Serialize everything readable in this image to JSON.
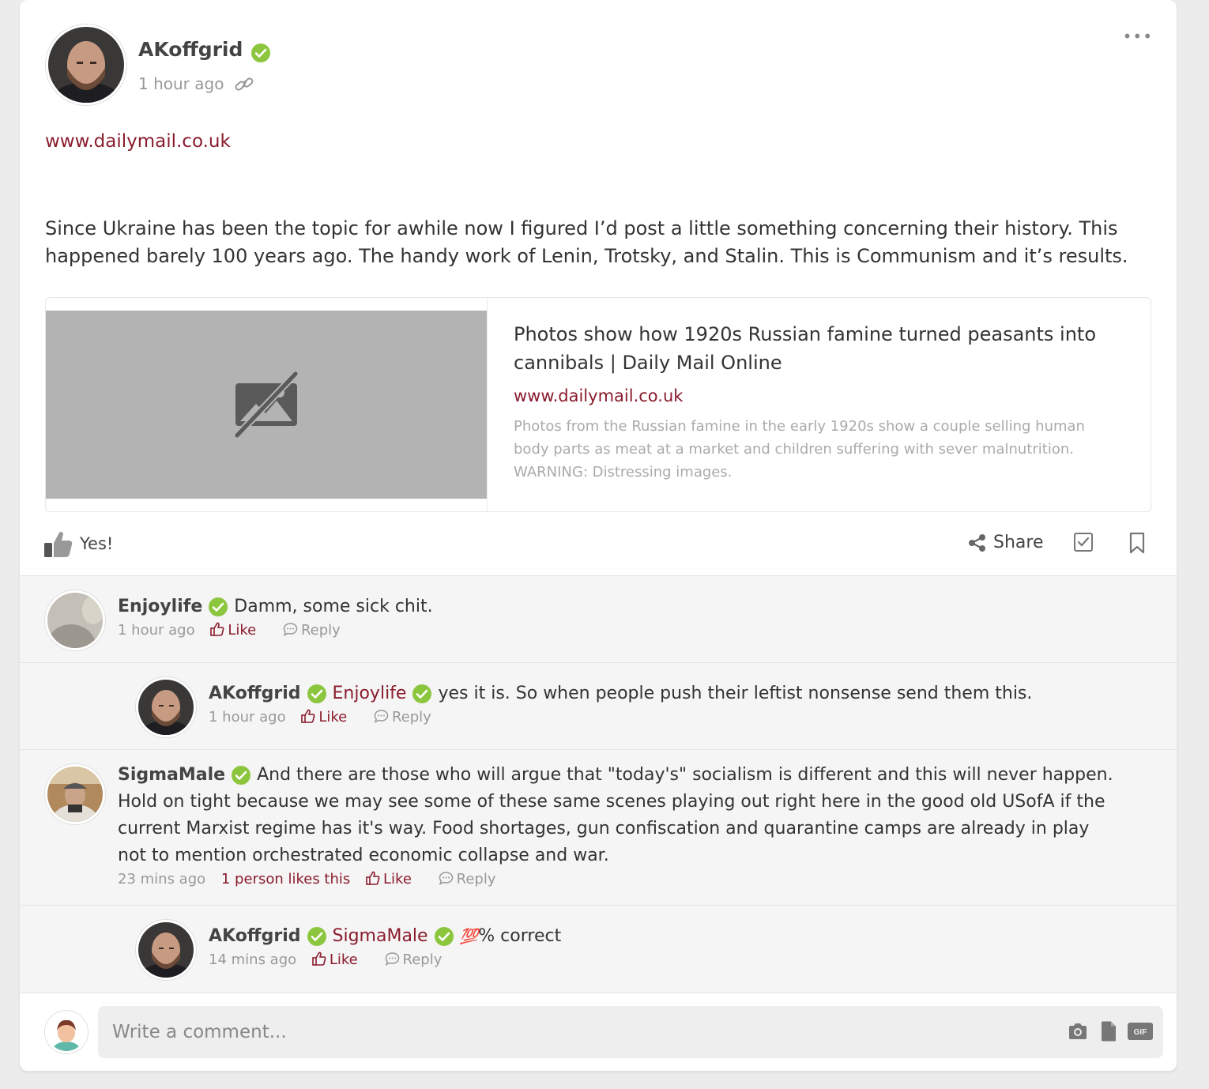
{
  "post": {
    "author": "AKoffgrid",
    "time": "1 hour ago",
    "link": "www.dailymail.co.uk",
    "text": "Since Ukraine has been the topic for awhile now I figured I’d post a little something concerning their history. This happened barely 100 years ago. The handy work of Lenin, Trotsky, and Stalin. This is Communism and it’s results.",
    "preview": {
      "title": "Photos show how 1920s Russian famine turned peasants into cannibals | Daily Mail Online",
      "site": "www.dailymail.co.uk",
      "description": "Photos from the Russian famine in the early 1920s show a couple selling human body parts as meat at a market and children suffering with sever malnutrition. WARNING: Distressing images."
    },
    "reaction_label": "Yes!",
    "share_label": "Share"
  },
  "comments": [
    {
      "author": "Enjoylife",
      "mention": "",
      "text": "Damm, some sick chit.",
      "time": "1 hour ago",
      "likes_text": "",
      "like_label": "Like",
      "reply_label": "Reply"
    },
    {
      "author": "AKoffgrid",
      "mention": "Enjoylife",
      "text": "yes it is. So when people push their leftist nonsense send them this.",
      "time": "1 hour ago",
      "likes_text": "",
      "like_label": "Like",
      "reply_label": "Reply"
    },
    {
      "author": "SigmaMale",
      "mention": "",
      "text": "And there are those who will argue that \"today's\" socialism is different and this will never happen. Hold on tight because we may see some of these same scenes playing out right here in the good old USofA if the current Marxist regime has it's way. Food shortages, gun confiscation and quarantine camps are already in play not to mention orchestrated economic collapse and war.",
      "time": "23 mins ago",
      "likes_text": "1 person likes this",
      "like_label": "Like",
      "reply_label": "Reply"
    },
    {
      "author": "AKoffgrid",
      "mention": "SigmaMale",
      "emoji": "💯",
      "text": "% correct",
      "time": "14 mins ago",
      "likes_text": "",
      "like_label": "Like",
      "reply_label": "Reply"
    }
  ],
  "composer": {
    "placeholder": "Write a comment..."
  },
  "colors": {
    "accent": "#8a1c2d",
    "verified": "#8cc63f",
    "muted": "#999999"
  },
  "icons": [
    "more-icon",
    "verified-icon",
    "link-icon",
    "image-off-icon",
    "thumbs-up-icon",
    "share-icon",
    "check-square-icon",
    "bookmark-icon",
    "thumb-like-icon",
    "reply-bubble-icon",
    "camera-icon",
    "file-icon",
    "gif-icon"
  ]
}
